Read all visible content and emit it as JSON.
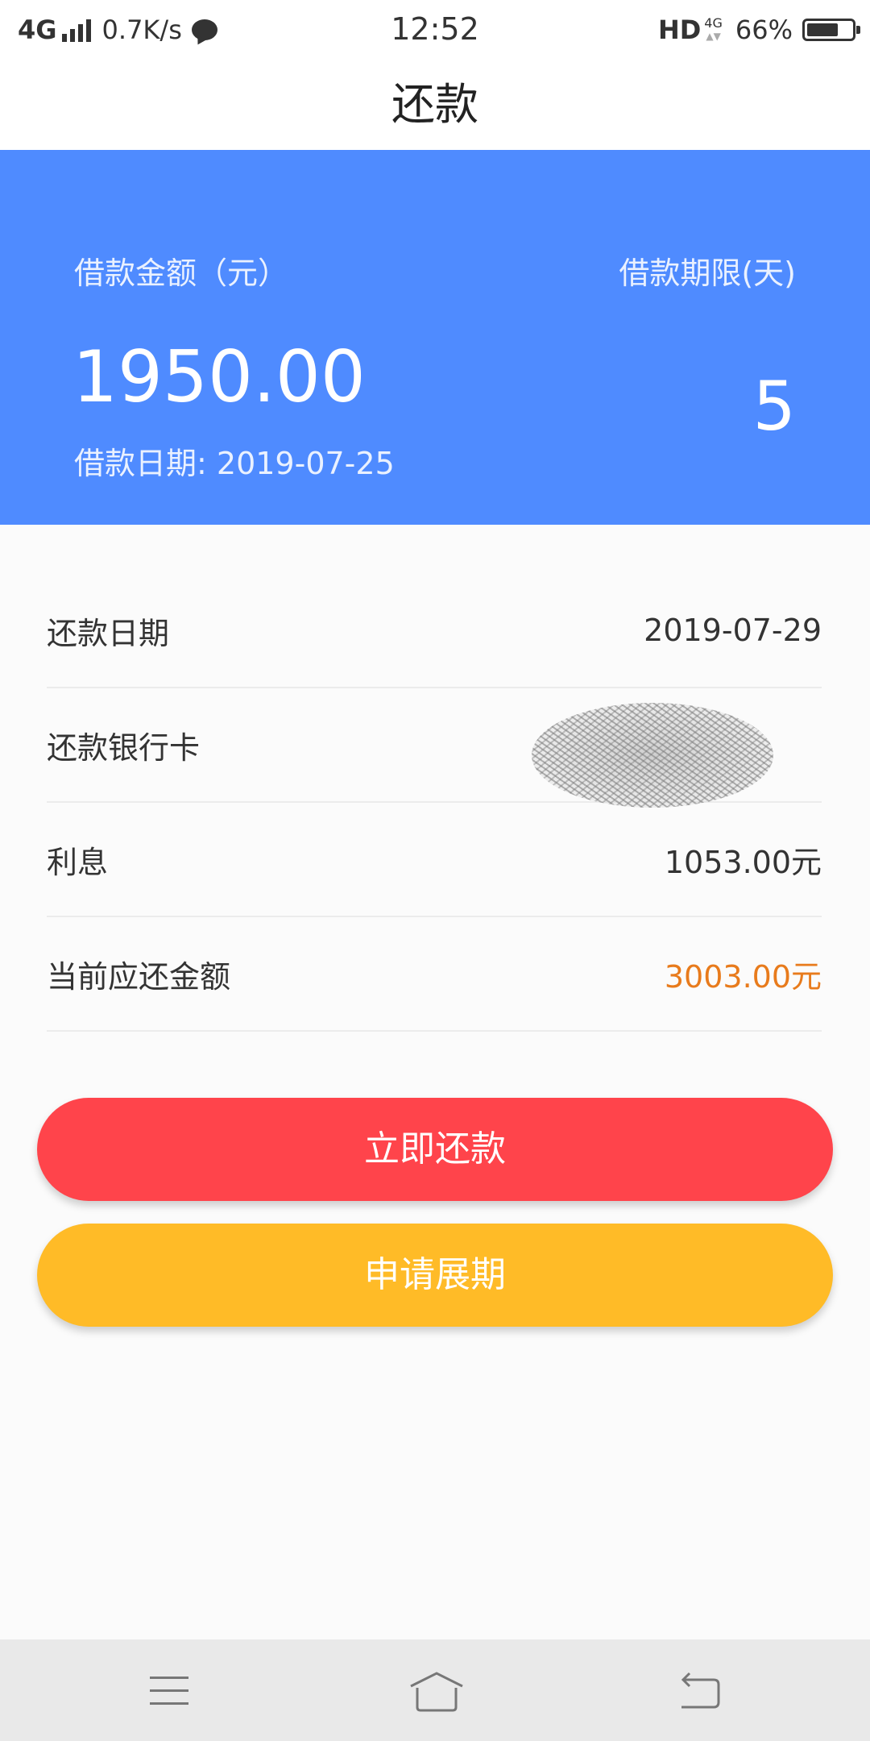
{
  "status_bar": {
    "network": "4G",
    "speed": "0.7K/s",
    "time": "12:52",
    "hd": "HD",
    "net_type": "4G",
    "battery": "66%"
  },
  "title": "还款",
  "loan_card": {
    "amount_label": "借款金额（元）",
    "term_label": "借款期限(天)",
    "amount": "1950.00",
    "term": "5",
    "date_label": "借款日期:",
    "date_value": "2019-07-25"
  },
  "info": {
    "repay_date_label": "还款日期",
    "repay_date_value": "2019-07-29",
    "bank_card_label": "还款银行卡",
    "interest_label": "利息",
    "interest_value": "1053.00元",
    "due_label": "当前应还金额",
    "due_value": "3003.00元"
  },
  "buttons": {
    "repay_now": "立即还款",
    "apply_extension": "申请展期"
  },
  "colors": {
    "header_blue": "#4f8bff",
    "repay_red": "#ff444b",
    "extend_yellow": "#ffbb27",
    "due_orange": "#e87b1c"
  },
  "icons": {
    "nav_left": "menu-icon",
    "nav_center": "home-icon",
    "nav_right": "back-icon"
  }
}
